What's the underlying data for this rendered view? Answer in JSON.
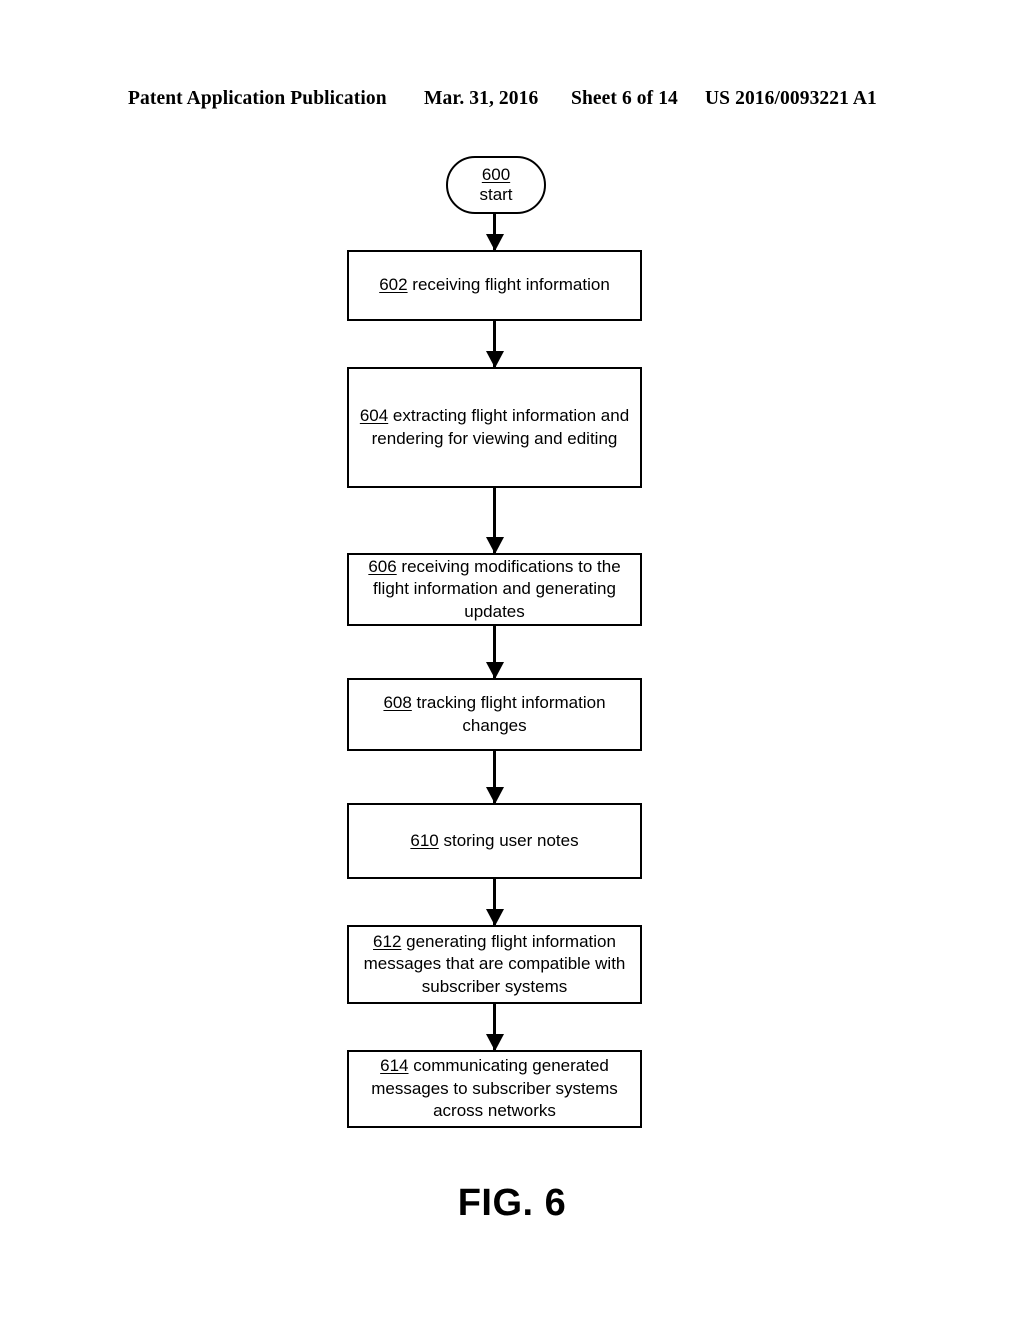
{
  "header": {
    "publication": "Patent Application Publication",
    "date": "Mar. 31, 2016",
    "sheet": "Sheet 6 of 14",
    "patent_number": "US 2016/0093221 A1"
  },
  "figure": {
    "caption": "FIG. 6",
    "type": "flowchart",
    "line_color": "#000000",
    "fill_color": "#ffffff"
  },
  "flowchart": {
    "start": {
      "ref": "600",
      "label": "start"
    },
    "steps": [
      {
        "ref": "602",
        "text": " receiving flight information"
      },
      {
        "ref": "604",
        "text": " extracting flight information and rendering for viewing and editing"
      },
      {
        "ref": "606",
        "text": " receiving modifications to the flight information and generating updates"
      },
      {
        "ref": "608",
        "text": " tracking flight information changes"
      },
      {
        "ref": "610",
        "text": " storing user notes"
      },
      {
        "ref": "612",
        "text": " generating flight information messages that are compatible with subscriber systems"
      },
      {
        "ref": "614",
        "text": " communicating generated messages to subscriber systems across networks"
      }
    ],
    "connectors": [
      {
        "from": "600",
        "to": "602"
      },
      {
        "from": "602",
        "to": "604"
      },
      {
        "from": "604",
        "to": "606"
      },
      {
        "from": "606",
        "to": "608"
      },
      {
        "from": "608",
        "to": "610"
      },
      {
        "from": "610",
        "to": "612"
      },
      {
        "from": "612",
        "to": "614"
      }
    ]
  }
}
